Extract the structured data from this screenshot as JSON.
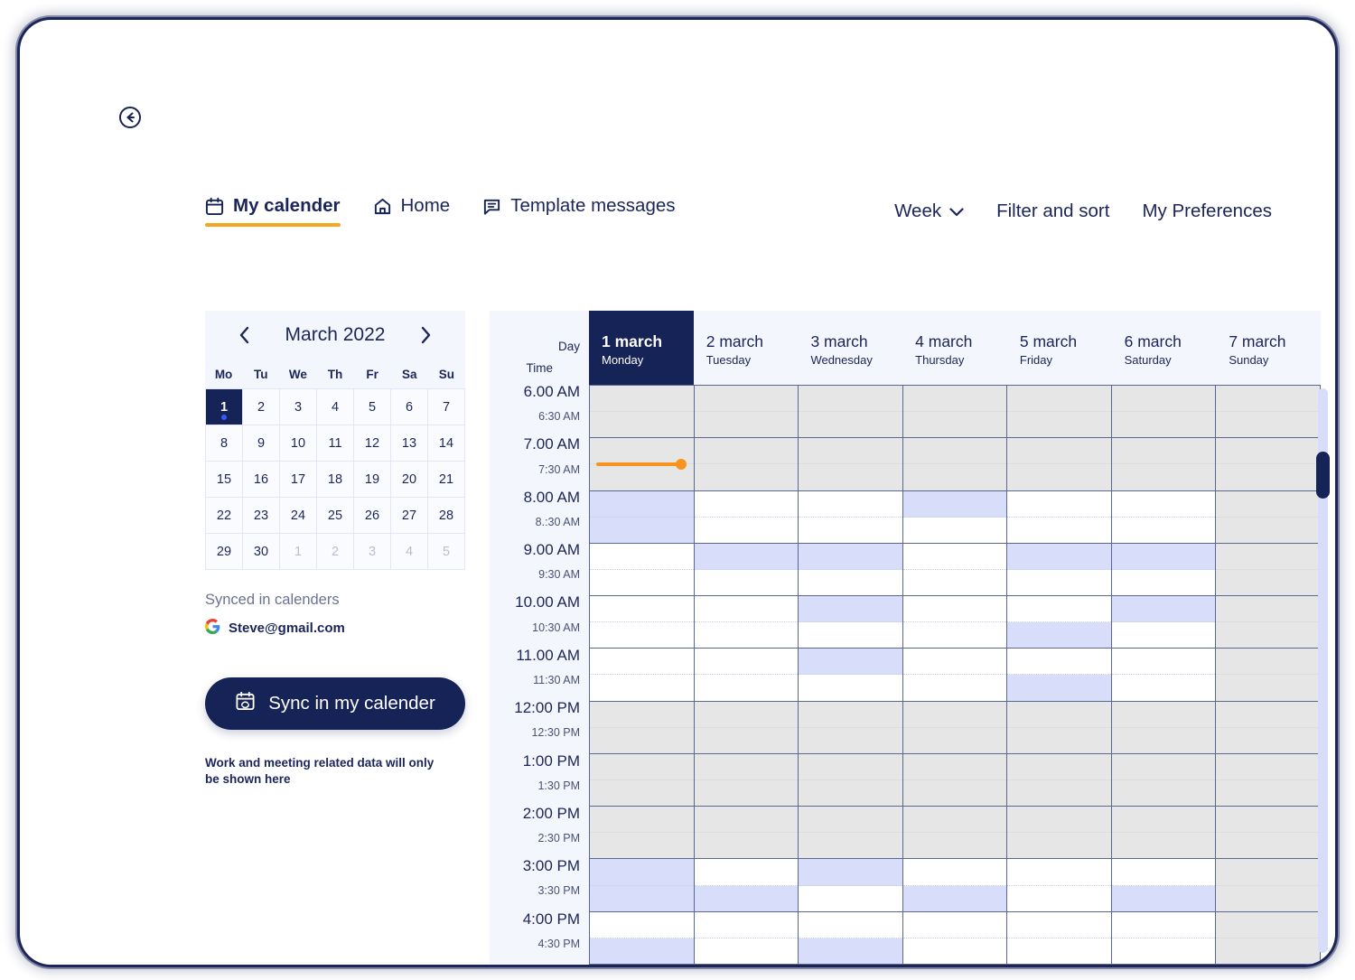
{
  "back_button": {
    "icon": "arrow-left-circle-icon"
  },
  "nav": {
    "left_items": [
      {
        "label": "My calender",
        "icon": "calendar-icon",
        "active": true
      },
      {
        "label": "Home",
        "icon": "home-icon",
        "active": false
      },
      {
        "label": "Template messages",
        "icon": "message-icon",
        "active": false
      }
    ],
    "right_items": [
      {
        "label": "Week",
        "icon": "chevron-down-icon"
      },
      {
        "label": "Filter and sort",
        "icon": ""
      },
      {
        "label": "My Preferences",
        "icon": ""
      }
    ]
  },
  "mini_calendar": {
    "title": "March 2022",
    "prev_icon": "chevron-left-icon",
    "next_icon": "chevron-right-icon",
    "day_headers": [
      "Mo",
      "Tu",
      "We",
      "Th",
      "Fr",
      "Sa",
      "Su"
    ],
    "weeks": [
      [
        {
          "n": "1",
          "other": false,
          "selected": true,
          "dot": true
        },
        {
          "n": "2",
          "other": false,
          "selected": false,
          "dot": false
        },
        {
          "n": "3",
          "other": false,
          "selected": false,
          "dot": false
        },
        {
          "n": "4",
          "other": false,
          "selected": false,
          "dot": false
        },
        {
          "n": "5",
          "other": false,
          "selected": false,
          "dot": false
        },
        {
          "n": "6",
          "other": false,
          "selected": false,
          "dot": false
        },
        {
          "n": "7",
          "other": false,
          "selected": false,
          "dot": false
        }
      ],
      [
        {
          "n": "8",
          "other": false,
          "selected": false,
          "dot": false
        },
        {
          "n": "9",
          "other": false,
          "selected": false,
          "dot": false
        },
        {
          "n": "10",
          "other": false,
          "selected": false,
          "dot": false
        },
        {
          "n": "11",
          "other": false,
          "selected": false,
          "dot": false
        },
        {
          "n": "12",
          "other": false,
          "selected": false,
          "dot": false
        },
        {
          "n": "13",
          "other": false,
          "selected": false,
          "dot": false
        },
        {
          "n": "14",
          "other": false,
          "selected": false,
          "dot": false
        }
      ],
      [
        {
          "n": "15",
          "other": false,
          "selected": false,
          "dot": false
        },
        {
          "n": "16",
          "other": false,
          "selected": false,
          "dot": false
        },
        {
          "n": "17",
          "other": false,
          "selected": false,
          "dot": false
        },
        {
          "n": "18",
          "other": false,
          "selected": false,
          "dot": false
        },
        {
          "n": "19",
          "other": false,
          "selected": false,
          "dot": false
        },
        {
          "n": "20",
          "other": false,
          "selected": false,
          "dot": false
        },
        {
          "n": "21",
          "other": false,
          "selected": false,
          "dot": false
        }
      ],
      [
        {
          "n": "22",
          "other": false,
          "selected": false,
          "dot": false
        },
        {
          "n": "23",
          "other": false,
          "selected": false,
          "dot": false
        },
        {
          "n": "24",
          "other": false,
          "selected": false,
          "dot": false
        },
        {
          "n": "25",
          "other": false,
          "selected": false,
          "dot": false
        },
        {
          "n": "26",
          "other": false,
          "selected": false,
          "dot": false
        },
        {
          "n": "27",
          "other": false,
          "selected": false,
          "dot": false
        },
        {
          "n": "28",
          "other": false,
          "selected": false,
          "dot": false
        }
      ],
      [
        {
          "n": "29",
          "other": false,
          "selected": false,
          "dot": false
        },
        {
          "n": "30",
          "other": false,
          "selected": false,
          "dot": false
        },
        {
          "n": "1",
          "other": true,
          "selected": false,
          "dot": false
        },
        {
          "n": "2",
          "other": true,
          "selected": false,
          "dot": false
        },
        {
          "n": "3",
          "other": true,
          "selected": false,
          "dot": false
        },
        {
          "n": "4",
          "other": true,
          "selected": false,
          "dot": false
        },
        {
          "n": "5",
          "other": true,
          "selected": false,
          "dot": false
        }
      ]
    ]
  },
  "sidebar": {
    "synced_label": "Synced in calenders",
    "account": "Steve@gmail.com",
    "account_icon": "google-g-icon",
    "sync_button": {
      "label": "Sync in my calender",
      "icon": "calendar-sync-icon"
    },
    "note": "Work and meeting related data will only be shown here"
  },
  "calendar": {
    "corner_day_label": "Day",
    "corner_time_label": "Time",
    "days": [
      {
        "date": "1 march",
        "name": "Monday",
        "selected": true
      },
      {
        "date": "2 march",
        "name": "Tuesday",
        "selected": false
      },
      {
        "date": "3 march",
        "name": "Wednesday",
        "selected": false
      },
      {
        "date": "4 march",
        "name": "Thursday",
        "selected": false
      },
      {
        "date": "5 march",
        "name": "Friday",
        "selected": false
      },
      {
        "date": "6 march",
        "name": "Saturday",
        "selected": false
      },
      {
        "date": "7 march",
        "name": "Sunday",
        "selected": false
      }
    ],
    "hour_labels": [
      "6.00 AM",
      "7.00 AM",
      "8.00 AM",
      "9.00 AM",
      "10.00 AM",
      "11.00 AM",
      "12:00 PM",
      "1:00 PM",
      "2:00 PM",
      "3:00 PM",
      "4:00 PM"
    ],
    "half_labels": [
      "6:30 AM",
      "7:30 AM",
      "8.:30 AM",
      "9:30 AM",
      "10:30 AM",
      "11:30 AM",
      "12:30 PM",
      "1:30 PM",
      "2:30 PM",
      "3:30 PM",
      "4:30 PM"
    ],
    "legend_colors": {
      "unavailable": "#e6e6e6",
      "available": "#ffffff",
      "booked": "#d8ddfa",
      "selected_day": "#162356",
      "now_marker": "#f7941d"
    },
    "now_marker": {
      "time": "7:30 AM",
      "day_index": 0
    },
    "slots": [
      {
        "day": "Monday",
        "cells": [
          "g",
          "g",
          "g",
          "g",
          "b",
          "b",
          "w",
          "w",
          "w",
          "w",
          "w",
          "w",
          "g",
          "g",
          "g",
          "g",
          "g",
          "g",
          "b",
          "b",
          "w",
          "b"
        ]
      },
      {
        "day": "Tuesday",
        "cells": [
          "g",
          "g",
          "g",
          "g",
          "w",
          "w",
          "b",
          "w",
          "w",
          "w",
          "w",
          "w",
          "g",
          "g",
          "g",
          "g",
          "g",
          "g",
          "w",
          "b",
          "w",
          "w"
        ]
      },
      {
        "day": "Wednesday",
        "cells": [
          "g",
          "g",
          "g",
          "g",
          "w",
          "w",
          "b",
          "w",
          "b",
          "w",
          "b",
          "w",
          "g",
          "g",
          "g",
          "g",
          "g",
          "g",
          "b",
          "w",
          "w",
          "b"
        ]
      },
      {
        "day": "Thursday",
        "cells": [
          "g",
          "g",
          "g",
          "g",
          "b",
          "w",
          "w",
          "w",
          "w",
          "w",
          "w",
          "w",
          "g",
          "g",
          "g",
          "g",
          "g",
          "g",
          "w",
          "b",
          "w",
          "w"
        ]
      },
      {
        "day": "Friday",
        "cells": [
          "g",
          "g",
          "g",
          "g",
          "w",
          "w",
          "b",
          "w",
          "w",
          "b",
          "w",
          "b",
          "g",
          "g",
          "g",
          "g",
          "g",
          "g",
          "w",
          "w",
          "w",
          "w"
        ]
      },
      {
        "day": "Saturday",
        "cells": [
          "g",
          "g",
          "g",
          "g",
          "w",
          "w",
          "b",
          "w",
          "b",
          "w",
          "w",
          "w",
          "g",
          "g",
          "g",
          "g",
          "g",
          "g",
          "w",
          "b",
          "w",
          "w"
        ]
      },
      {
        "day": "Sunday",
        "cells": [
          "g",
          "g",
          "g",
          "g",
          "g",
          "g",
          "g",
          "g",
          "g",
          "g",
          "g",
          "g",
          "g",
          "g",
          "g",
          "g",
          "g",
          "g",
          "g",
          "g",
          "g",
          "g"
        ]
      }
    ]
  },
  "scrollbar": {
    "orientation": "vertical"
  }
}
